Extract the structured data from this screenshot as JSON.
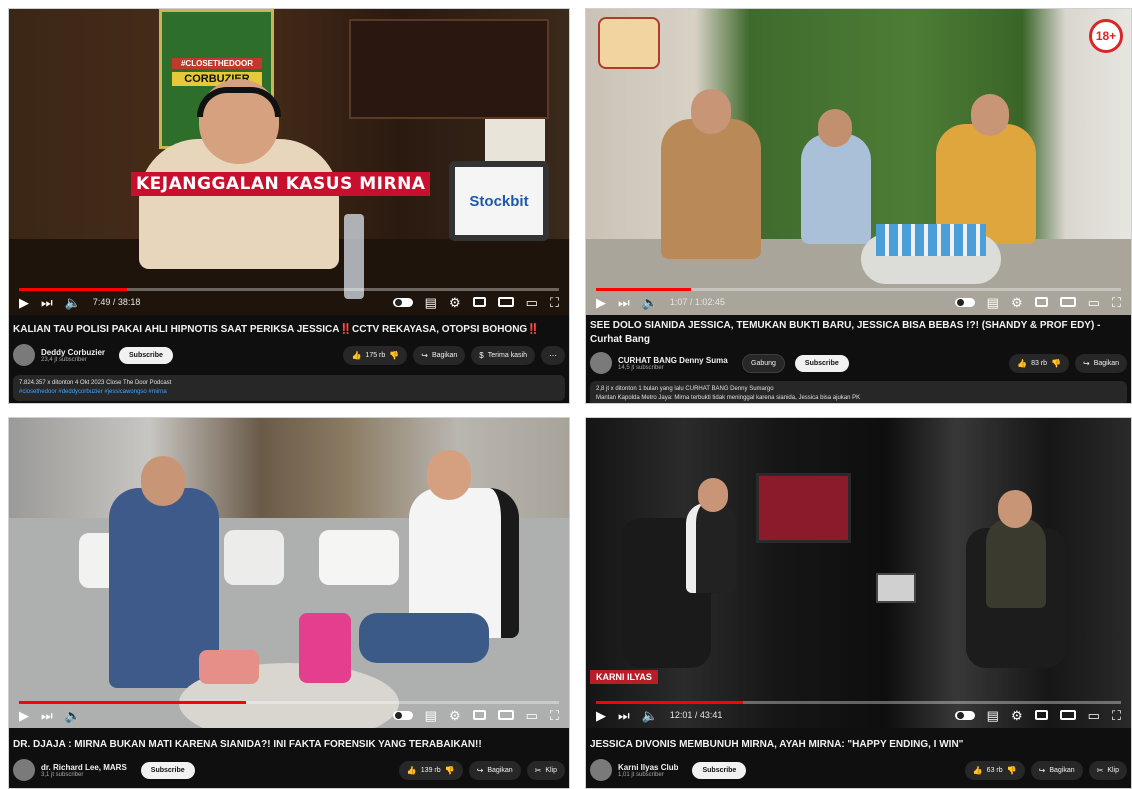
{
  "panels": {
    "p1": {
      "overlay_text": "KEJANGGALAN KASUS MIRNA",
      "sticker_top": "#CLOSETHEDOOR",
      "sticker_bottom": "CORBUZIER",
      "sponsor": "Stockbit",
      "time": "7:49 / 38:18",
      "progress": 0.2,
      "title_main": "KALIAN TAU POLISI PAKAI AHLI HIPNOTIS SAAT PERIKSA JESSICA",
      "title_mid": "CCTV REKAYASA, OTOPSI BOHONG",
      "excl": "‼️",
      "channel": "Deddy Corbuzier",
      "subs": "23,4 jt subscriber",
      "subscribe": "Subscribe",
      "likes": "175 rb",
      "share": "Bagikan",
      "thanks": "Terima kasih",
      "desc_line1": "7.824.357 x ditonton  4 Okt 2023  Close The Door Podcast",
      "desc_line2": "#closethedoor #deddycorbuzier #jessicawongso #mirna"
    },
    "p2": {
      "rating": "18+",
      "time": "1:07 / 1:02:45",
      "progress": 0.18,
      "title": "SEE DOLO SIANIDA JESSICA, TEMUKAN BUKTI BARU, JESSICA BISA BEBAS !?! (SHANDY & PROF EDY) - Curhat Bang",
      "channel": "CURHAT BANG Denny Sumargo",
      "subs": "14,5 jt subscriber",
      "join": "Gabung",
      "subscribe": "Subscribe",
      "likes": "83 rb",
      "share": "Bagikan",
      "desc_line1": "2,8 jt x ditonton  1 bulan yang lalu  CURHAT BANG Denny Sumargo",
      "desc_line2": "Mantan Kapolda Metro Jaya: Mirna terbukti tidak meninggal karena sianida, Jessica bisa ajukan PK"
    },
    "p3": {
      "time": "",
      "progress": 0.42,
      "title": "DR. DJAJA : MIRNA BUKAN MATI KARENA SIANIDA?! INI FAKTA FORENSIK YANG TERABAIKAN!!",
      "channel": "dr. Richard Lee, MARS",
      "subs": "3,1 jt subscriber",
      "subscribe": "Subscribe",
      "likes": "139 rb",
      "share": "Bagikan",
      "clip": "Klip"
    },
    "p4": {
      "time": "12:01 / 43:41",
      "progress": 0.28,
      "title": "JESSICA DIVONIS MEMBUNUH MIRNA, AYAH MIRNA: \"HAPPY ENDING, I WIN\"",
      "channel": "Karni Ilyas Club",
      "subs": "1,01 jt subscriber",
      "subscribe": "Subscribe",
      "likes": "63 rb",
      "share": "Bagikan",
      "clip": "Klip",
      "banner": "KARNI ILYAS"
    }
  },
  "colors": {
    "accent_red": "#ff0000",
    "yt_dark": "#0f0f0f",
    "pill": "#272727",
    "link": "#3ea6ff"
  },
  "icons": [
    "play-icon",
    "next-icon",
    "volume-icon",
    "autoplay-toggle",
    "subtitles-icon",
    "settings-icon",
    "miniplayer-icon",
    "theater-icon",
    "cast-icon",
    "fullscreen-icon",
    "like-icon",
    "dislike-icon",
    "share-icon",
    "more-icon"
  ]
}
